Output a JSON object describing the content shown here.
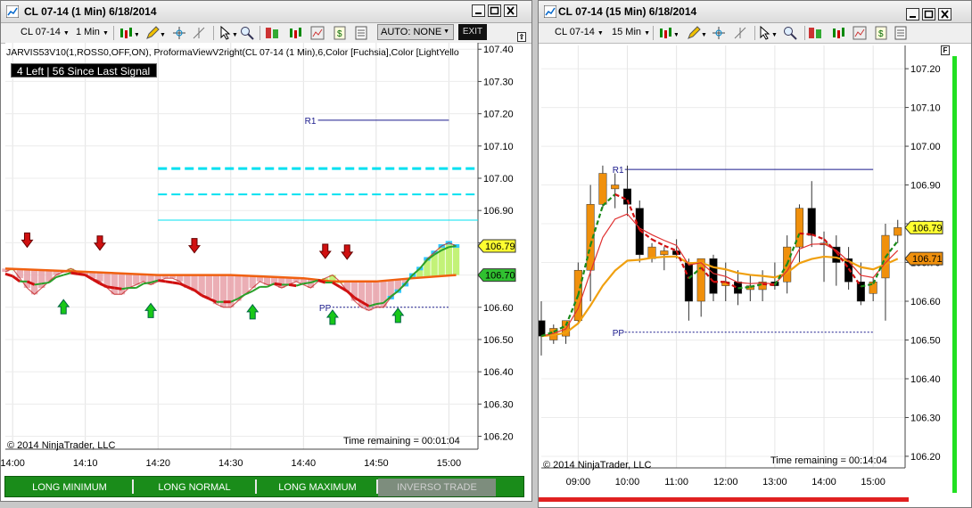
{
  "left": {
    "title": "CL 07-14 (1 Min)  6/18/2014",
    "toolbar": {
      "instrument": "CL 07-14",
      "interval": "1 Min",
      "auto": "AUTO: NONE",
      "exit": "EXIT"
    },
    "indicator_label": "JARVIS53V10(1,ROSS0,OFF,ON), ProformaViewV2right(CL 07-14 (1 Min),6,Color [Fuchsia],Color [LightYello",
    "signal_box": "4 Left | 56 Since Last Signal",
    "copyright": "© 2014 NinjaTrader, LLC",
    "time_remaining": "Time remaining = 00:01:04",
    "trade_buttons": [
      "LONG MINIMUM",
      "LONG NORMAL",
      "LONG MAXIMUM",
      "INVERSO TRADE"
    ],
    "level_r1": "R1",
    "level_pp": "PP"
  },
  "right": {
    "title": "CL 07-14 (15 Min)  6/18/2014",
    "toolbar": {
      "instrument": "CL 07-14",
      "interval": "15 Min"
    },
    "copyright": "© 2014 NinjaTrader, LLC",
    "time_remaining": "Time remaining = 00:14:04",
    "level_r1": "R1",
    "level_pp": "PP"
  },
  "colors": {
    "bull": "#f0900c",
    "bear": "#000000",
    "accent_cyan": "#00e0f0",
    "trade_green": "#1a8c1a"
  },
  "chart_data": [
    {
      "type": "line",
      "title": "CL 07-14 (1 Min)  6/18/2014",
      "x_ticks": [
        "14:00",
        "14:10",
        "14:20",
        "14:30",
        "14:40",
        "14:50",
        "15:00"
      ],
      "y_ticks": [
        107.4,
        107.3,
        107.2,
        107.1,
        107.0,
        106.9,
        106.8,
        106.7,
        106.6,
        106.5,
        106.4,
        106.3,
        106.2
      ],
      "ylim": [
        106.16,
        107.42
      ],
      "xlim_minutes": [
        -1,
        64
      ],
      "price": {
        "x_minutes": [
          -1,
          0,
          1,
          2,
          3,
          4,
          5,
          6,
          7,
          8,
          9,
          10,
          11,
          12,
          13,
          14,
          15,
          16,
          17,
          18,
          19,
          20,
          21,
          22,
          23,
          24,
          25,
          26,
          27,
          28,
          29,
          30,
          31,
          32,
          33,
          34,
          35,
          36,
          37,
          38,
          39,
          40,
          41,
          42,
          43,
          44,
          45,
          46,
          47,
          48,
          49,
          50,
          51,
          52,
          53,
          54,
          55,
          56,
          57,
          58,
          59,
          60,
          61
        ],
        "y": [
          106.71,
          106.72,
          106.69,
          106.66,
          106.64,
          106.66,
          106.68,
          106.7,
          106.71,
          106.72,
          106.71,
          106.7,
          106.69,
          106.68,
          106.66,
          106.64,
          106.64,
          106.66,
          106.67,
          106.68,
          106.67,
          106.68,
          106.69,
          106.69,
          106.68,
          106.66,
          106.65,
          106.64,
          106.63,
          106.61,
          106.6,
          106.6,
          106.62,
          106.64,
          106.66,
          106.68,
          106.67,
          106.67,
          106.66,
          106.67,
          106.68,
          106.67,
          106.66,
          106.68,
          106.69,
          106.7,
          106.68,
          106.65,
          106.62,
          106.6,
          106.59,
          106.6,
          106.6,
          106.63,
          106.65,
          106.67,
          106.7,
          106.72,
          106.75,
          106.77,
          106.79,
          106.8,
          106.79
        ]
      },
      "moving_average": {
        "x_minutes": [
          -1,
          10,
          20,
          30,
          40,
          44,
          50,
          55,
          61
        ],
        "y": [
          106.72,
          106.71,
          106.7,
          106.7,
          106.69,
          106.68,
          106.68,
          106.69,
          106.7
        ]
      },
      "levels": [
        {
          "label": "R1",
          "value": 107.18
        },
        {
          "label": "PP",
          "value": 106.6
        }
      ],
      "cyan_levels": [
        107.03,
        106.95,
        106.87
      ],
      "signals_down_minutes": [
        2,
        12,
        25,
        43,
        46
      ],
      "signals_up_minutes": [
        7,
        19,
        33,
        44,
        53
      ],
      "last_price": 106.79,
      "marker_price": 106.7
    },
    {
      "type": "bar",
      "title": "CL 07-14 (15 Min)  6/18/2014",
      "x_ticks": [
        "09:00",
        "10:00",
        "11:00",
        "12:00",
        "13:00",
        "14:00",
        "15:00"
      ],
      "y_ticks": [
        107.2,
        107.1,
        107.0,
        106.9,
        106.8,
        106.7,
        106.6,
        106.5,
        106.4,
        106.3,
        106.2
      ],
      "ylim": [
        106.17,
        107.26
      ],
      "xlim_hours": [
        8.25,
        15.65
      ],
      "candles": [
        {
          "o": 106.55,
          "h": 106.6,
          "l": 106.46,
          "c": 106.51
        },
        {
          "o": 106.5,
          "h": 106.54,
          "l": 106.49,
          "c": 106.53
        },
        {
          "o": 106.51,
          "h": 106.55,
          "l": 106.49,
          "c": 106.55
        },
        {
          "o": 106.55,
          "h": 106.7,
          "l": 106.54,
          "c": 106.68
        },
        {
          "o": 106.68,
          "h": 106.9,
          "l": 106.6,
          "c": 106.85
        },
        {
          "o": 106.85,
          "h": 106.95,
          "l": 106.84,
          "c": 106.93
        },
        {
          "o": 106.89,
          "h": 106.93,
          "l": 106.84,
          "c": 106.9
        },
        {
          "o": 106.89,
          "h": 106.95,
          "l": 106.82,
          "c": 106.85
        },
        {
          "o": 106.84,
          "h": 106.86,
          "l": 106.7,
          "c": 106.72
        },
        {
          "o": 106.71,
          "h": 106.75,
          "l": 106.7,
          "c": 106.74
        },
        {
          "o": 106.72,
          "h": 106.74,
          "l": 106.68,
          "c": 106.73
        },
        {
          "o": 106.73,
          "h": 106.76,
          "l": 106.71,
          "c": 106.72
        },
        {
          "o": 106.7,
          "h": 106.71,
          "l": 106.55,
          "c": 106.6
        },
        {
          "o": 106.6,
          "h": 106.7,
          "l": 106.56,
          "c": 106.71
        },
        {
          "o": 106.71,
          "h": 106.72,
          "l": 106.6,
          "c": 106.62
        },
        {
          "o": 106.64,
          "h": 106.7,
          "l": 106.6,
          "c": 106.65
        },
        {
          "o": 106.65,
          "h": 106.68,
          "l": 106.59,
          "c": 106.62
        },
        {
          "o": 106.63,
          "h": 106.67,
          "l": 106.6,
          "c": 106.64
        },
        {
          "o": 106.63,
          "h": 106.68,
          "l": 106.6,
          "c": 106.65
        },
        {
          "o": 106.65,
          "h": 106.7,
          "l": 106.63,
          "c": 106.64
        },
        {
          "o": 106.65,
          "h": 106.77,
          "l": 106.62,
          "c": 106.74
        },
        {
          "o": 106.74,
          "h": 106.85,
          "l": 106.7,
          "c": 106.84
        },
        {
          "o": 106.84,
          "h": 106.91,
          "l": 106.74,
          "c": 106.77
        },
        {
          "o": 106.75,
          "h": 106.78,
          "l": 106.65,
          "c": 106.75
        },
        {
          "o": 106.74,
          "h": 106.77,
          "l": 106.64,
          "c": 106.7
        },
        {
          "o": 106.71,
          "h": 106.74,
          "l": 106.63,
          "c": 106.65
        },
        {
          "o": 106.65,
          "h": 106.7,
          "l": 106.59,
          "c": 106.6
        },
        {
          "o": 106.62,
          "h": 106.66,
          "l": 106.6,
          "c": 106.65
        },
        {
          "o": 106.66,
          "h": 106.8,
          "l": 106.55,
          "c": 106.77
        },
        {
          "o": 106.77,
          "h": 106.81,
          "l": 106.75,
          "c": 106.79
        }
      ],
      "levels": [
        {
          "label": "R1",
          "value": 106.94
        },
        {
          "label": "PP",
          "value": 106.52
        }
      ],
      "last_price": 106.79,
      "average_price": 106.71
    }
  ]
}
